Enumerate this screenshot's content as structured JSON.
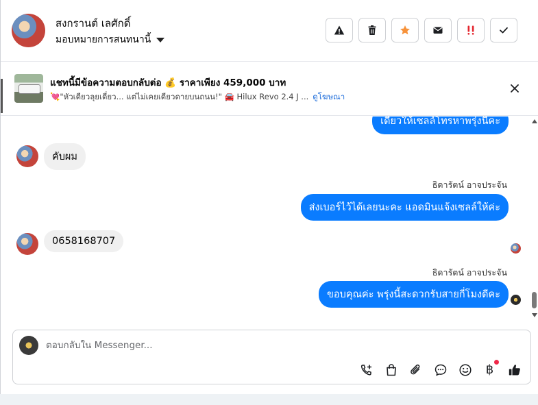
{
  "header": {
    "contact_name": "สงกรานต์ เลศักดิ์",
    "assign_label": "มอบหมายการสนทนานี้",
    "actions": [
      {
        "name": "report-button",
        "icon": "warning-icon"
      },
      {
        "name": "delete-button",
        "icon": "trash-icon"
      },
      {
        "name": "star-button",
        "icon": "star-icon"
      },
      {
        "name": "mark-unread-button",
        "icon": "envelope-icon"
      },
      {
        "name": "follow-up-button",
        "icon": "double-exclamation-icon"
      },
      {
        "name": "done-button",
        "icon": "check-icon"
      }
    ]
  },
  "ad": {
    "title": "แชทนี้มีข้อความตอบกลับต่อ 💰 ราคาเพียง 459,000 บาท",
    "subtitle": "💘\"หัวเดียวลุยเดี่ยว... แต่ไม่เคยเดียวดายบนถนน!\" 🚘 Hilux Revo 2.4 J ...",
    "link": "ดูโฆษณา"
  },
  "messages": [
    {
      "direction": "out",
      "text": "เดี๋ยวให้เซลล์โทรหาพรุ่งนี้คะ"
    },
    {
      "direction": "in",
      "text": "คับผม"
    },
    {
      "direction": "out",
      "sender": "ธิดารัตน์ อาจประจัน",
      "text": "ส่งเบอร์ไว้ได้เลยนะคะ แอดมินแจ้งเซลล์ให้ค่ะ"
    },
    {
      "direction": "in",
      "text": "0658168707"
    },
    {
      "direction": "out",
      "sender": "ธิดารัตน์ อาจประจัน",
      "text": "ขอบคุณค่ะ พรุ่งนี้สะดวกรับสายกี่โมงดีคะ"
    }
  ],
  "composer": {
    "placeholder": "ตอบกลับใน Messenger...",
    "currency_symbol": "฿",
    "tools": [
      "add-call-icon",
      "shopping-bag-icon",
      "paperclip-icon",
      "chat-bubble-icon",
      "emoji-icon",
      "baht-icon",
      "thumbs-up-icon"
    ]
  },
  "colors": {
    "outgoing_bubble": "#0a7cff",
    "incoming_bubble": "#f0f0f0",
    "link": "#216fdb",
    "star": "#f7923a",
    "urgent": "#e4262e",
    "notification_dot": "#f02849"
  }
}
